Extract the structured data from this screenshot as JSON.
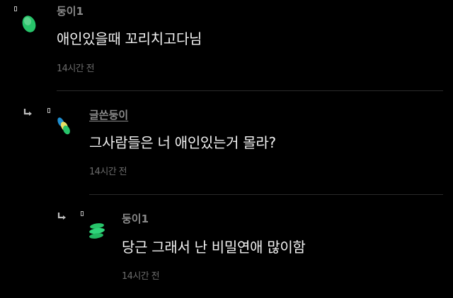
{
  "comments": [
    {
      "author": "둥이1",
      "text": "애인있을때 꼬리치고다님",
      "time": "14시간 전",
      "is_reply": false,
      "author_underlined": false,
      "avatar_icon": "green-bean-avatar-icon"
    },
    {
      "author": "글쓴둥이",
      "text": "그사람들은 너 애인있는거 몰라?",
      "time": "14시간 전",
      "is_reply": true,
      "author_underlined": true,
      "avatar_icon": "multi-bean-avatar-icon"
    },
    {
      "author": "둥이1",
      "text": "당근 그래서 난 비밀연애 많이함",
      "time": "14시간 전",
      "is_reply": true,
      "author_underlined": false,
      "avatar_icon": "stacked-bean-avatar-icon"
    }
  ],
  "colors": {
    "background": "#000000",
    "author": "#8a8a8a",
    "text": "#f2f2f2",
    "time": "#6c6c6c",
    "accent_green": "#2ecc71"
  }
}
